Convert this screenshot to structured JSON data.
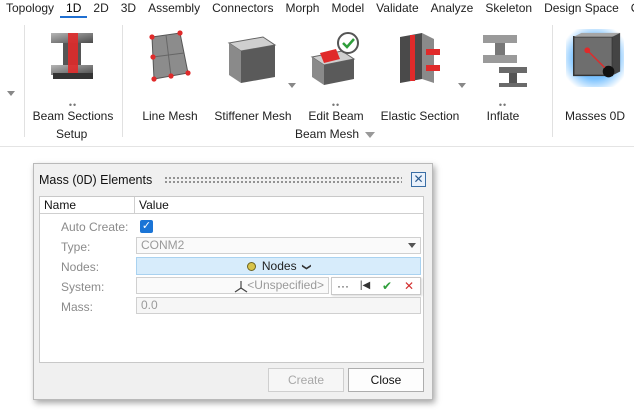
{
  "menu": {
    "items": [
      "Topology",
      "1D",
      "2D",
      "3D",
      "Assembly",
      "Connectors",
      "Morph",
      "Model",
      "Validate",
      "Analyze",
      "Skeleton",
      "Design Space",
      "Op"
    ],
    "active": "1D"
  },
  "ribbon": {
    "tools": {
      "beam_sections": "Beam Sections",
      "line_mesh": "Line Mesh",
      "stiffener_mesh": "Stiffener Mesh",
      "edit_beam": "Edit Beam",
      "elastic_section": "Elastic Section",
      "inflate": "Inflate",
      "masses_0d": "Masses 0D"
    },
    "groups": {
      "setup": "Setup",
      "beam_mesh": "Beam Mesh"
    },
    "more_dots": "••"
  },
  "dialog": {
    "title": "Mass (0D) Elements",
    "close_glyph": "✕",
    "columns": {
      "name": "Name",
      "value": "Value"
    },
    "rows": {
      "auto_create": {
        "label": "Auto Create:",
        "checked": true,
        "glyph": "✓"
      },
      "type": {
        "label": "Type:",
        "value": "CONM2"
      },
      "nodes": {
        "label": "Nodes:",
        "value": "Nodes",
        "chevron": "❯"
      },
      "system": {
        "label": "System:",
        "value": "<Unspecified>",
        "tools": {
          "more": "···",
          "first": "|◀",
          "accept": "✔",
          "reject": "✕"
        }
      },
      "mass": {
        "label": "Mass:",
        "value": "0.0"
      }
    },
    "buttons": {
      "create": "Create",
      "close": "Close"
    }
  },
  "colors": {
    "accent": "#1f6fd1",
    "checkbox": "#1a74d6",
    "nodes_bg": "#d7ecfb",
    "accept": "#2e9e3a",
    "reject": "#d32f2f"
  }
}
